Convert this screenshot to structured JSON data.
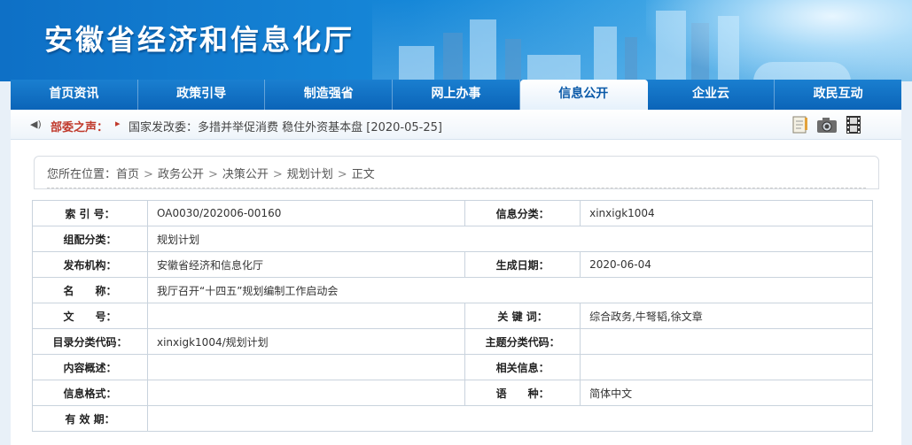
{
  "site": {
    "title": "安徽省经济和信息化厅"
  },
  "nav": {
    "items": [
      {
        "label": "首页资讯",
        "active": false
      },
      {
        "label": "政策引导",
        "active": false
      },
      {
        "label": "制造强省",
        "active": false
      },
      {
        "label": "网上办事",
        "active": false
      },
      {
        "label": "信息公开",
        "active": true
      },
      {
        "label": "企业云",
        "active": false
      },
      {
        "label": "政民互动",
        "active": false
      }
    ]
  },
  "ticker": {
    "label": "部委之声：",
    "arrow": "▸",
    "news": "国家发改委：多措并举促消费 稳住外资基本盘 [2020-05-25]"
  },
  "toolbar": {
    "icons": [
      "notepad-icon",
      "camera-icon",
      "film-icon"
    ]
  },
  "breadcrumb": {
    "prefix": "您所在位置：",
    "items": [
      "首页",
      "政务公开",
      "决策公开",
      "规划计划",
      "正文"
    ]
  },
  "meta": {
    "index_no_label": "索 引 号：",
    "index_no": "OA0030/202006-00160",
    "category_label": "信息分类：",
    "category": "xinxigk1004",
    "group_label": "组配分类：",
    "group": "规划计划",
    "publisher_label": "发布机构：",
    "publisher": "安徽省经济和信息化厅",
    "date_label": "生成日期：",
    "date": "2020-06-04",
    "name_label": "名　　称：",
    "name": "我厅召开“十四五”规划编制工作启动会",
    "doc_no_label": "文　　号：",
    "doc_no": "",
    "keywords_label": "关 键 词：",
    "keywords": "综合政务,牛弩韬,徐文章",
    "catalog_label": "目录分类代码：",
    "catalog": "xinxigk1004/规划计划",
    "topic_label": "主题分类代码：",
    "topic": "",
    "summary_label": "内容概述：",
    "summary": "",
    "related_label": "相关信息：",
    "related": "",
    "format_label": "信息格式：",
    "format": "",
    "language_label": "语　　种：",
    "language": "简体中文",
    "validity_label": "有 效 期：",
    "validity": ""
  }
}
